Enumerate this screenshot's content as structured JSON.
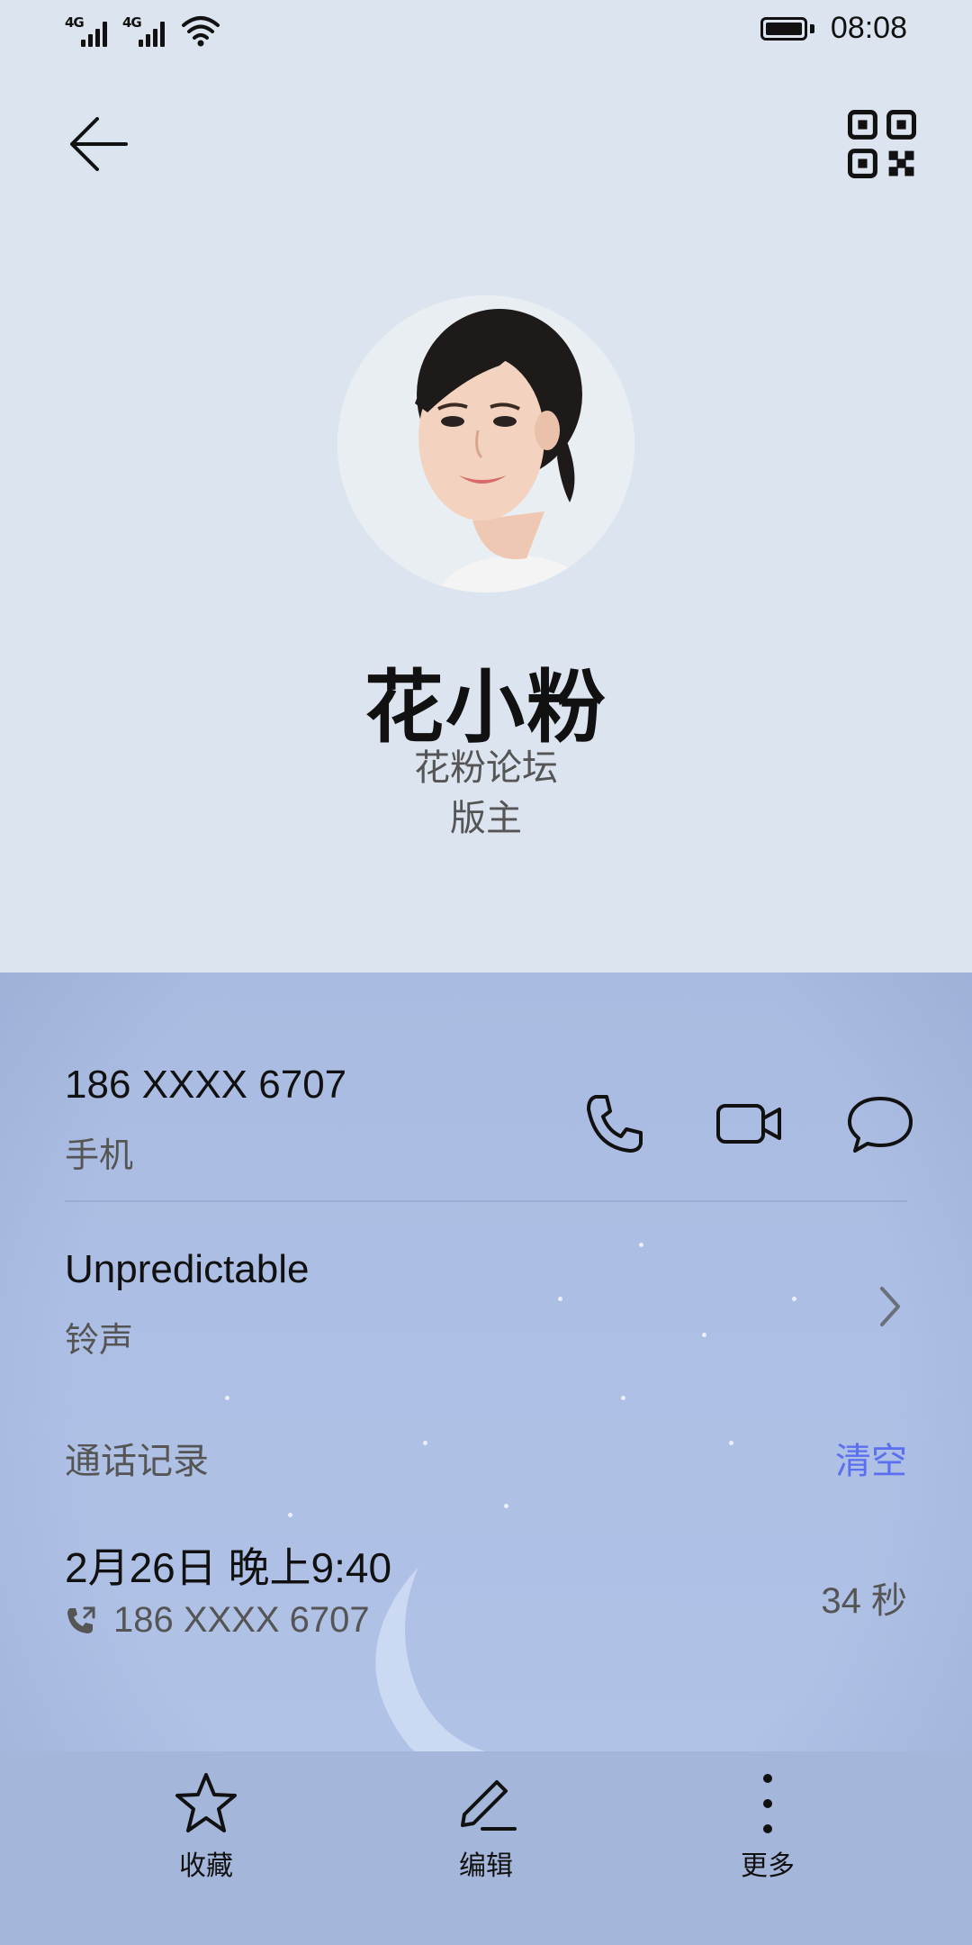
{
  "status_bar": {
    "signal1": "4G",
    "signal2": "4G",
    "time": "08:08"
  },
  "contact": {
    "name": "花小粉",
    "company": "花粉论坛",
    "job_title": "版主"
  },
  "phone": {
    "number": "186 XXXX 6707",
    "type": "手机"
  },
  "ringtone": {
    "name": "Unpredictable",
    "label": "铃声"
  },
  "call_log": {
    "title": "通话记录",
    "clear_label": "清空",
    "accent_color": "#5b6ff0",
    "entries": [
      {
        "datetime": "2月26日 晚上9:40",
        "number": "186 XXXX 6707",
        "duration": "34 秒"
      }
    ]
  },
  "bottom_bar": {
    "favorite_label": "收藏",
    "edit_label": "编辑",
    "more_label": "更多"
  }
}
